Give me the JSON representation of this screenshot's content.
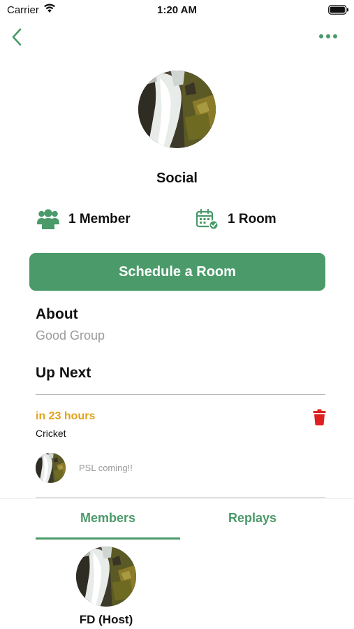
{
  "status_bar": {
    "carrier": "Carrier",
    "time": "1:20 AM",
    "icons": [
      "wifi-icon",
      "battery-icon"
    ]
  },
  "nav": {
    "back_icon": "chevron-left-icon",
    "more_icon": "more-horizontal-icon"
  },
  "group": {
    "avatar_image": "waterfall-photo",
    "name": "Social",
    "members_label": "1 Member",
    "rooms_label": "1 Room"
  },
  "actions": {
    "schedule_label": "Schedule a Room"
  },
  "about": {
    "heading": "About",
    "text": "Good Group"
  },
  "up_next": {
    "heading": "Up Next",
    "event": {
      "time": "in 23 hours",
      "title": "Cricket",
      "description": "PSL coming!!",
      "delete_icon": "trash-icon"
    }
  },
  "tabs": {
    "items": [
      {
        "label": "Members",
        "active": true
      },
      {
        "label": "Replays",
        "active": false
      }
    ]
  },
  "members": [
    {
      "name": "FD (Host)"
    }
  ],
  "colors": {
    "accent": "#4a9a6a",
    "event_time": "#e2a21a",
    "delete": "#e02020",
    "muted_text": "#9a9a9a"
  }
}
